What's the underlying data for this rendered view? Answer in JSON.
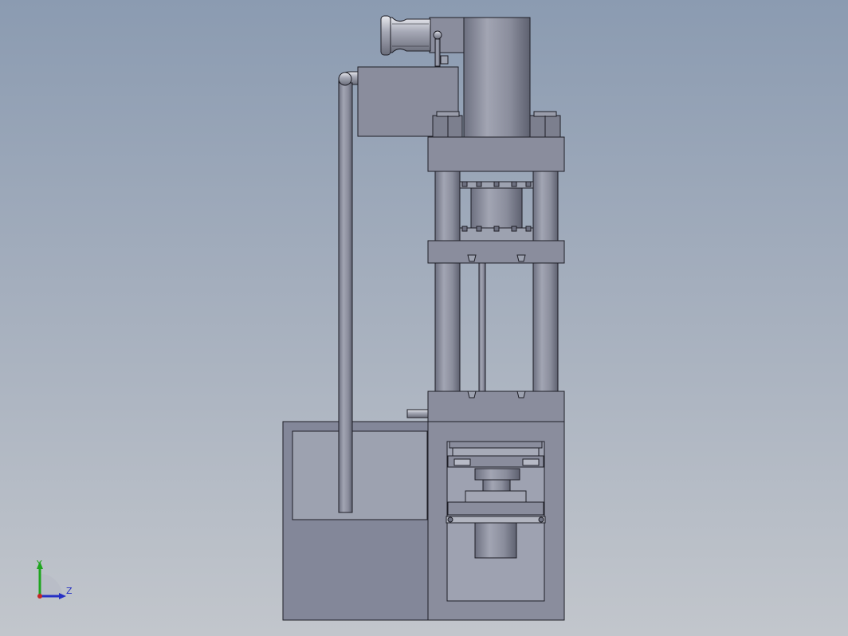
{
  "viewport": {
    "model": "hydraulic-press",
    "background_top": "#8b9bb1",
    "background_bottom": "#c2c6cc",
    "part_fill": "#8a8d9d",
    "part_stroke": "#1e1e26"
  },
  "triad": {
    "y_label": "Y",
    "z_label": "Z",
    "y_color": "#1fa51f",
    "z_color": "#2630c4",
    "x_color": "#c42626"
  }
}
